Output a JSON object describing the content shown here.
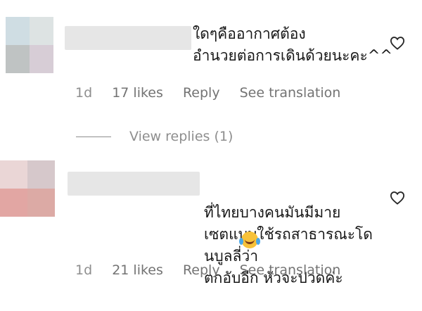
{
  "comments": [
    {
      "text": "ใดๆคืออากาศต้อง\nอำนวยต่อการเดินด้วยนะคะ^^",
      "time": "1d",
      "likes": "17 likes",
      "reply": "Reply",
      "translate": "See translation",
      "avatar_colors": [
        "#cfdde3",
        "#dde3e3",
        "#bfc3c3",
        "#d7cdd6"
      ]
    },
    {
      "text": "ที่ไทยบางคนมันมีมาย\nเซตแบบใช้รถสาธารณะโดนบูลลี่ว่า\nตกอับอีก หัวจะปวดค่ะ",
      "emoji": "face-with-tears-of-joy",
      "time": "1d",
      "likes": "21 likes",
      "reply": "Reply",
      "translate": "See translation",
      "avatar_colors": [
        "#ead6d6",
        "#d6c8cb",
        "#e2a6a3",
        "#dcaaa5"
      ]
    }
  ],
  "view_replies": "View replies (1)",
  "icons": {
    "like": "heart-outline-icon"
  }
}
